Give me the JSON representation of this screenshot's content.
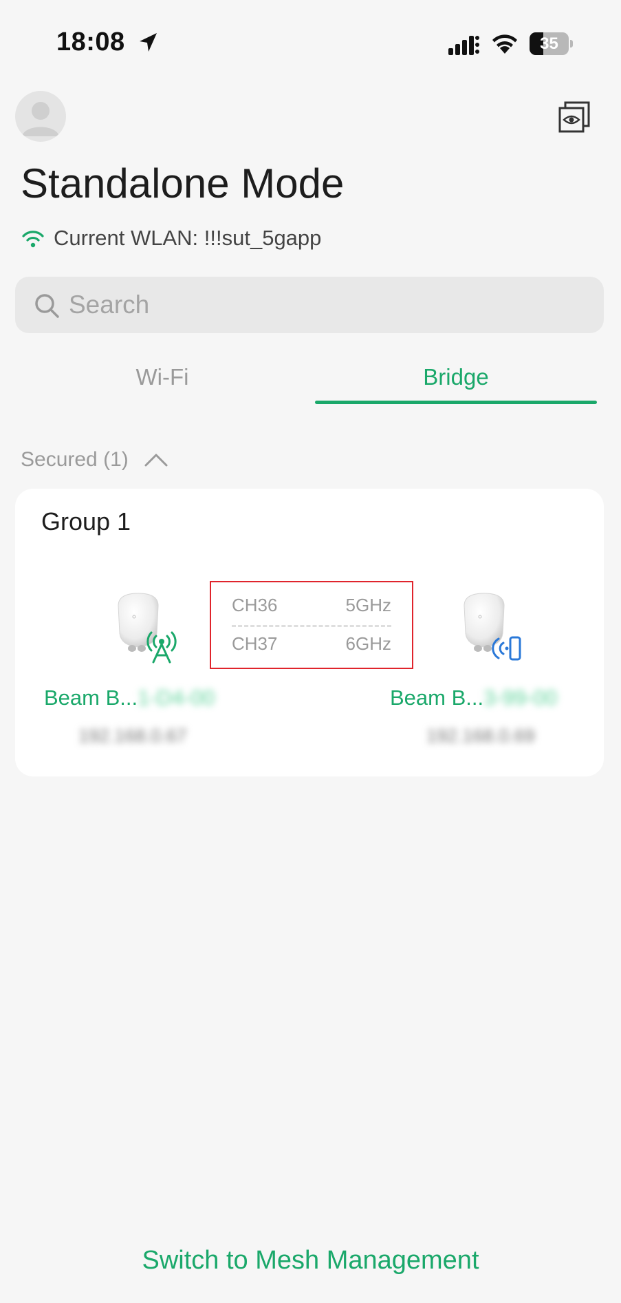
{
  "status_bar": {
    "time": "18:08",
    "battery_level": "35",
    "battery_fraction": 0.35
  },
  "header": {
    "title": "Standalone Mode",
    "current_wlan": "Current WLAN: !!!sut_5gapp"
  },
  "search": {
    "placeholder": "Search"
  },
  "tabs": [
    {
      "label": "Wi-Fi",
      "selected": false
    },
    {
      "label": "Bridge",
      "selected": true
    }
  ],
  "section": {
    "label": "Secured (1)",
    "expanded": true
  },
  "group": {
    "title": "Group 1",
    "devices": [
      {
        "name": "Beam B...",
        "name_suffix": "1-D4-00",
        "ip": "192.168.0.67",
        "role_icon": "antenna-icon"
      },
      {
        "name": "Beam B...",
        "name_suffix": "3-99-00",
        "ip": "192.168.0.69",
        "role_icon": "bridge-client-icon"
      }
    ],
    "channels": [
      {
        "channel": "CH36",
        "band": "5GHz"
      },
      {
        "channel": "CH37",
        "band": "6GHz"
      }
    ]
  },
  "footer": {
    "switch_label": "Switch to Mesh Management"
  },
  "colors": {
    "accent": "#1aa86a",
    "highlight_box": "#e0242c",
    "bridge_icon": "#2a78d8"
  }
}
